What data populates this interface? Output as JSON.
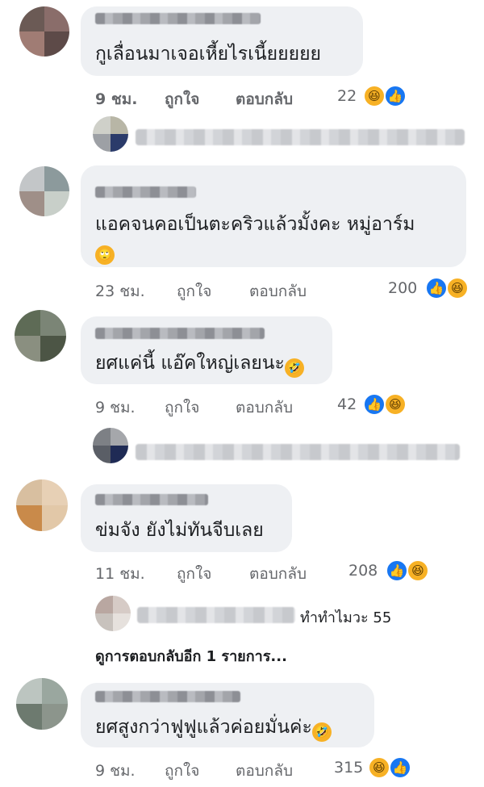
{
  "comments": [
    {
      "text": "กูเลื่อนมาเจอเหี้ยไรเนี้ยยยยย",
      "time": "9 ชม.",
      "like_label": "ถูกใจ",
      "reply_label": "ตอบกลับ",
      "reaction_count": "22",
      "reactions": [
        "haha-icon",
        "like-icon"
      ]
    },
    {
      "text": "แอคจนคอเป็นตะคริวแล้วมั้งคะ หมู่อาร์ม",
      "time": "23 ชม.",
      "like_label": "ถูกใจ",
      "reply_label": "ตอบกลับ",
      "reaction_count": "200",
      "reactions": [
        "like-icon",
        "haha-icon"
      ]
    },
    {
      "text": "ยศแค่นี้ แอ๊คใหญ่เลยนะ",
      "time": "9 ชม.",
      "like_label": "ถูกใจ",
      "reply_label": "ตอบกลับ",
      "reaction_count": "42",
      "reactions": [
        "like-icon",
        "haha-icon"
      ]
    },
    {
      "text": "ข่มจัง ยังไม่ทันจีบเลย",
      "time": "11 ชม.",
      "like_label": "ถูกใจ",
      "reply_label": "ตอบกลับ",
      "reaction_count": "208",
      "reactions": [
        "like-icon",
        "haha-icon"
      ],
      "reply_preview": "ทำทำไมวะ 55",
      "more_replies": "ดูการตอบกลับอีก 1 รายการ..."
    },
    {
      "text": "ยศสูงกว่าฟูฟูแล้วค่อยมั่นค่ะ",
      "time": "9 ชม.",
      "like_label": "ถูกใจ",
      "reply_label": "ตอบกลับ",
      "reaction_count": "315",
      "reactions": [
        "haha-icon",
        "like-icon"
      ]
    }
  ],
  "colors": {
    "bubble": "#eef0f3",
    "meta_text": "#65676b",
    "like_blue": "#1877f2",
    "haha_yellow": "#f7b125"
  }
}
